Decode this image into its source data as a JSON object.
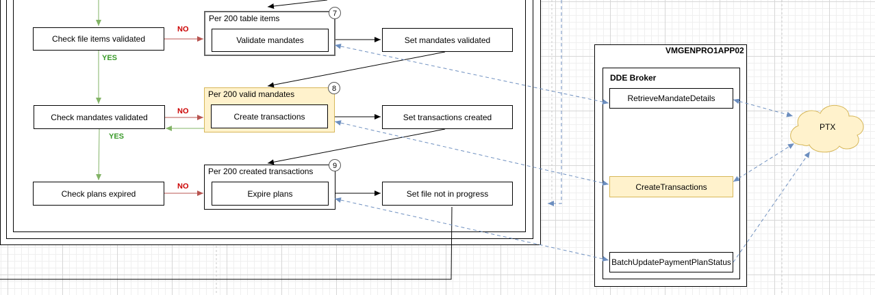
{
  "flow": {
    "check_file_items": "Check file items validated",
    "check_mandates": "Check mandates validated",
    "check_plans": "Check plans expired",
    "no_label": "NO",
    "yes_label": "YES"
  },
  "groups": [
    {
      "title": "Per 200 table items",
      "badge": "7",
      "inner": "Validate mandates",
      "result": "Set mandates validated"
    },
    {
      "title": "Per 200 valid mandates",
      "badge": "8",
      "inner": "Create transactions",
      "result": "Set transactions created"
    },
    {
      "title": "Per 200 created transactions",
      "badge": "9",
      "inner": "Expire plans",
      "result": "Set file not in progress"
    }
  ],
  "server": {
    "name": "VMGENPRO1APP02",
    "broker_title": "DDE Broker",
    "services": [
      "RetrieveMandateDetails",
      "CreateTransactions",
      "BatchUpdatePaymentPlanStatus"
    ]
  },
  "external": {
    "cloud_label": "PTX"
  },
  "colors": {
    "highlight_fill": "#fff2cc",
    "highlight_stroke": "#d6b656",
    "no_arrow": "#b85450",
    "yes_arrow": "#82b366",
    "dashed_link": "#6c8ebf",
    "no_text": "#cc0000",
    "yes_text": "#3a9a2a"
  }
}
